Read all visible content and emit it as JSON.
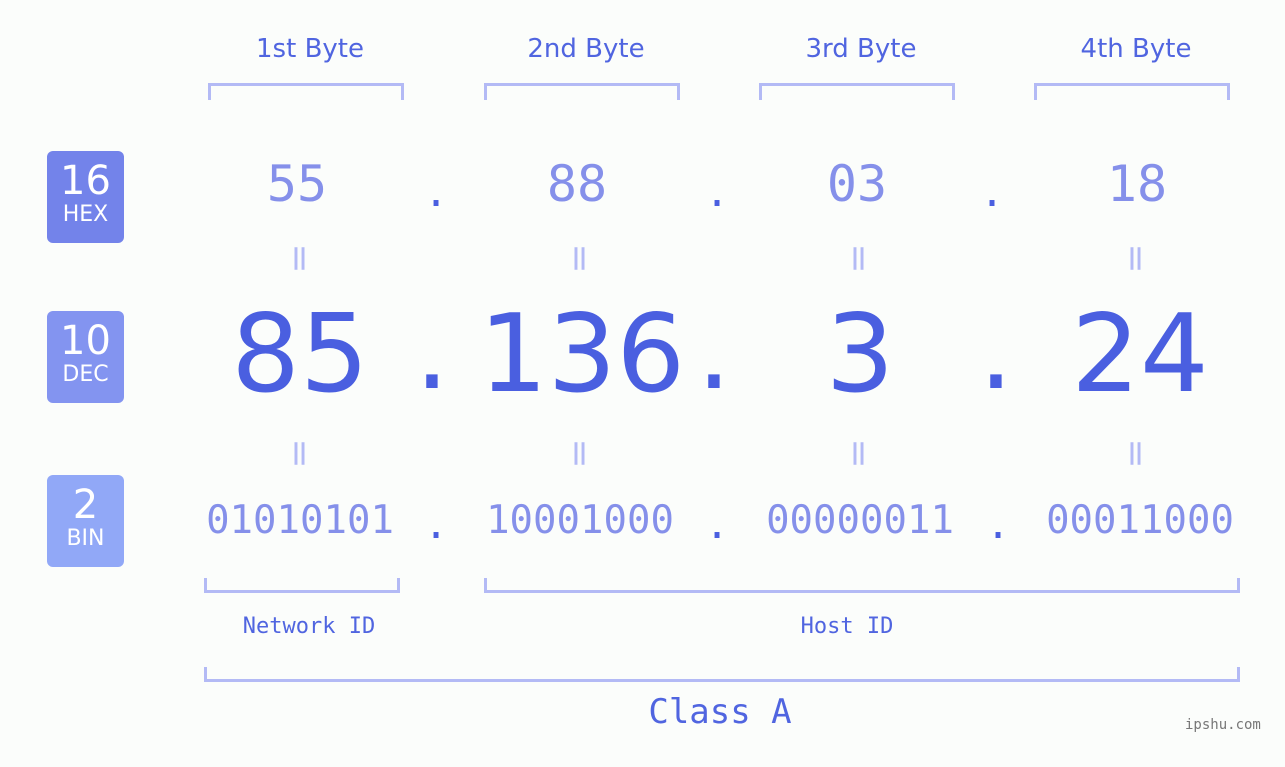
{
  "headers": [
    "1st Byte",
    "2nd Byte",
    "3rd Byte",
    "4th Byte"
  ],
  "badges": [
    {
      "number": "16",
      "label": "HEX",
      "color": "#7383ea"
    },
    {
      "number": "10",
      "label": "DEC",
      "color": "#8394f0"
    },
    {
      "number": "2",
      "label": "BIN",
      "color": "#91a8f7"
    }
  ],
  "hex": [
    "55",
    "88",
    "03",
    "18"
  ],
  "dec": [
    "85",
    "136",
    "3",
    "24"
  ],
  "bin": [
    "01010101",
    "10001000",
    "00000011",
    "00011000"
  ],
  "separator": ".",
  "equals": "=",
  "network_label": "Network ID",
  "host_label": "Host ID",
  "class_label": "Class A",
  "watermark": "ipshu.com"
}
